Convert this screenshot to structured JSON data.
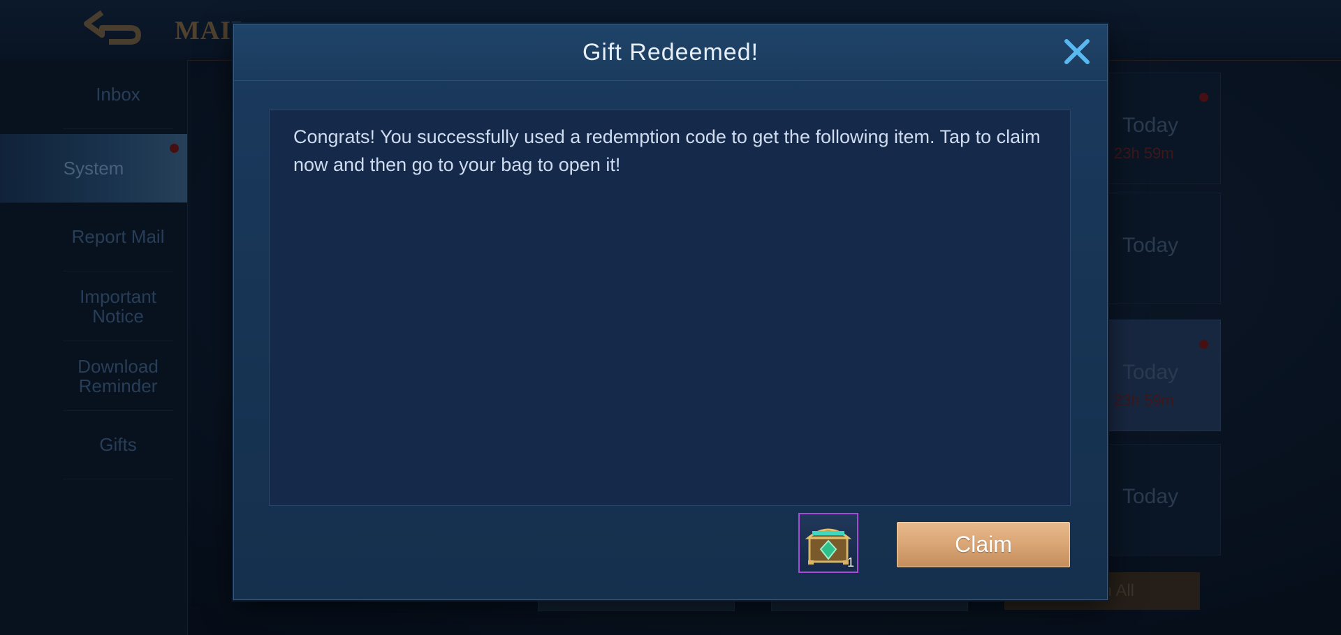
{
  "header": {
    "title": "MAIL"
  },
  "sidebar": {
    "items": [
      {
        "label": "Inbox"
      },
      {
        "label": "System"
      },
      {
        "label": "Report Mail"
      },
      {
        "label": "Important Notice"
      },
      {
        "label": "Download Reminder"
      },
      {
        "label": "Gifts"
      }
    ]
  },
  "mail_list": {
    "cards": [
      {
        "date": "Today",
        "time": "23h 59m"
      },
      {
        "date": "Today"
      },
      {
        "date": "Today",
        "time": "23h 59m"
      },
      {
        "date": "Today"
      }
    ],
    "claim_all_label": "Claim All"
  },
  "modal": {
    "title": "Gift Redeemed!",
    "message": "Congrats! You successfully used a redemption code to get the following item. Tap to claim now and then go to your bag to open it!",
    "reward": {
      "icon": "treasure-chest-icon",
      "quantity": "1"
    },
    "claim_label": "Claim"
  },
  "colors": {
    "accent_gold": "#d9a574",
    "modal_bg": "#173454",
    "item_border": "#a64bd6",
    "close_icon": "#5ab8f0"
  }
}
